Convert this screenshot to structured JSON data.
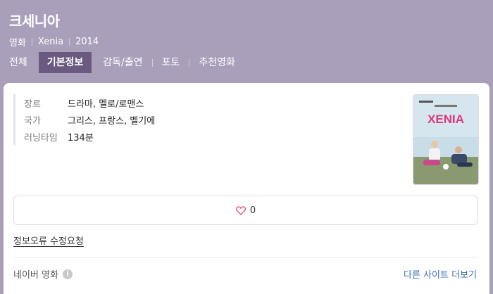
{
  "header": {
    "title": "크세니아",
    "meta": [
      "영화",
      "Xenia",
      "2014"
    ],
    "tabs": [
      {
        "label": "전체",
        "active": false
      },
      {
        "label": "기본정보",
        "active": true
      },
      {
        "label": "감독/출연",
        "active": false
      },
      {
        "label": "포토",
        "active": false
      },
      {
        "label": "추천영화",
        "active": false
      }
    ]
  },
  "info": [
    {
      "label": "장르",
      "value": "드라마, 멜로/로맨스"
    },
    {
      "label": "국가",
      "value": "그리스, 프랑스, 벨기에"
    },
    {
      "label": "러닝타임",
      "value": "134분"
    }
  ],
  "poster": {
    "title_text": "XENIA",
    "bg_color": "#c9dde8",
    "title_color": "#e0357a"
  },
  "like": {
    "count": "0",
    "icon": "heart-icon"
  },
  "report_link": "정보오류 수정요청",
  "footer": {
    "source": "네이버 영화",
    "info_icon": "info-icon",
    "info_glyph": "i",
    "more_link": "다른 사이트 더보기"
  },
  "colors": {
    "header_bg": "#a99fbb",
    "active_tab_bg": "#6b5a80",
    "link": "#3a6fb5"
  }
}
